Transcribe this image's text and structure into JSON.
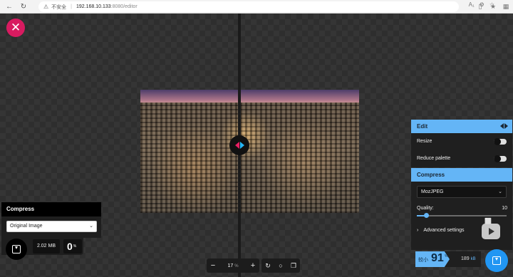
{
  "browser": {
    "insecure_label": "不安全",
    "url_host": "192.168.10.133",
    "url_path": ":8080/editor"
  },
  "editor": {
    "zoom_value": "17",
    "zoom_unit": "%"
  },
  "left_panel": {
    "title": "Compress",
    "method_selected": "Original Image",
    "file_size": "2.02 MB",
    "reduction_value": "0",
    "reduction_unit": "%"
  },
  "right_panel": {
    "edit_title": "Edit",
    "resize_label": "Resize",
    "resize_on": false,
    "reduce_palette_label": "Reduce palette",
    "reduce_palette_on": false,
    "compress_title": "Compress",
    "method_selected": "MozJPEG",
    "quality_label": "Quality:",
    "quality_value": "10",
    "quality_fraction": 0.1,
    "advanced_label": "Advanced settings",
    "result_prefix": "较小",
    "result_value": "91",
    "result_unit": "%",
    "result_size": "189",
    "result_size_unit": "kB"
  },
  "colors": {
    "accent_blue": "#64b5f6",
    "close_red": "#d81b60",
    "download_blue": "#2196f3"
  }
}
